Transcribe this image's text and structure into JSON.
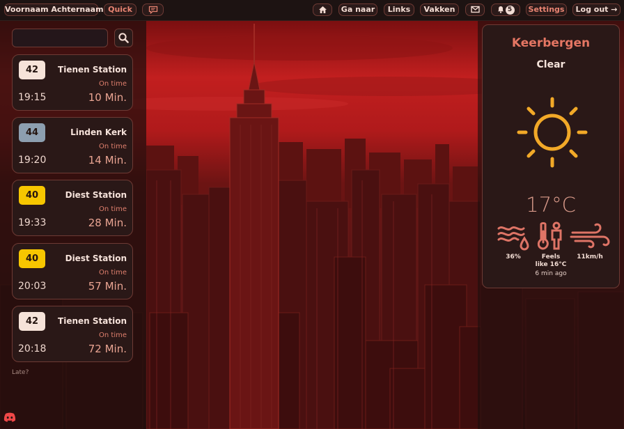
{
  "header": {
    "user_name": "Voornaam Achternaam",
    "quick_label": "Quick",
    "goto_label": "Ga naar",
    "links_label": "Links",
    "subjects_label": "Vakken",
    "notification_count": "5",
    "settings_label": "Settings",
    "logout_label": "Log out →"
  },
  "search": {
    "placeholder": "",
    "value": ""
  },
  "departures": [
    {
      "line": "42",
      "line_color": "#f6e3d9",
      "destination": "Tienen Station",
      "status": "On time",
      "time": "19:15",
      "minutes": "10 Min."
    },
    {
      "line": "44",
      "line_color": "#8d9fb0",
      "destination": "Linden Kerk",
      "status": "On time",
      "time": "19:20",
      "minutes": "14 Min."
    },
    {
      "line": "40",
      "line_color": "#f7c600",
      "destination": "Diest Station",
      "status": "On time",
      "time": "19:33",
      "minutes": "28 Min."
    },
    {
      "line": "40",
      "line_color": "#f7c600",
      "destination": "Diest Station",
      "status": "On time",
      "time": "20:03",
      "minutes": "57 Min."
    },
    {
      "line": "42",
      "line_color": "#f6e3d9",
      "destination": "Tienen Station",
      "status": "On time",
      "time": "20:18",
      "minutes": "72 Min."
    }
  ],
  "late_label": "Late?",
  "weather": {
    "location": "Keerbergen",
    "condition": "Clear",
    "temperature": "17°C",
    "humidity": "36%",
    "feels_like_line1": "Feels",
    "feels_like_line2": "like 16°C",
    "wind": "11km/h",
    "updated": "6 min ago",
    "sun_color": "#f2a928"
  },
  "colors": {
    "accent": "#e57663",
    "border": "#6e3a34",
    "panel": "#2a1817"
  }
}
